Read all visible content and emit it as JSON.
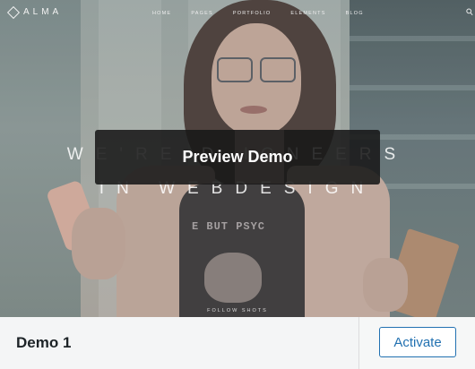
{
  "preview": {
    "site_logo": "ALMA",
    "nav_items": [
      "HOME",
      "PAGES",
      "PORTFOLIO",
      "ELEMENTS",
      "BLOG"
    ],
    "hero_line_1": "WE'RE D      IONEERS",
    "hero_line_2": "IN WEBDESIGN",
    "shirt_text": "E BUT PSYC",
    "caption": "FOLLOW SHOTS",
    "preview_button_label": "Preview Demo"
  },
  "footer": {
    "demo_name": "Demo 1",
    "activate_label": "Activate"
  },
  "colors": {
    "accent": "#2271b1",
    "footer_bg": "#f4f5f6",
    "overlay_button": "#181818"
  },
  "icons": [
    "diamond-logo-icon",
    "search-icon"
  ]
}
